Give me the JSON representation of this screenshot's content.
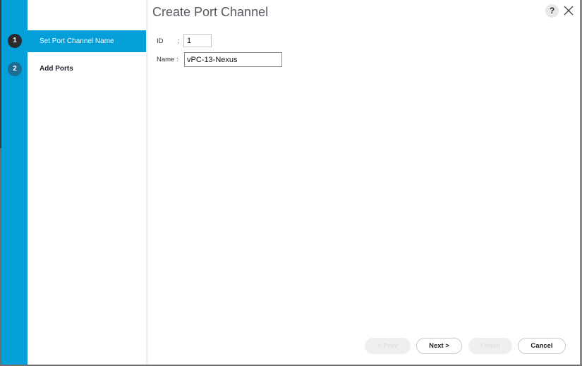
{
  "dialog": {
    "title": "Create Port Channel",
    "help_label": "?",
    "close_icon": "close-icon"
  },
  "steps": [
    {
      "number": "1",
      "label": "Set Port Channel Name",
      "active": true
    },
    {
      "number": "2",
      "label": "Add Ports",
      "active": false
    }
  ],
  "form": {
    "id_label": "ID",
    "id_colon": ":",
    "id_value": "1",
    "name_label": "Name :",
    "name_value": "vPC-13-Nexus"
  },
  "footer": {
    "prev_label": "< Prev",
    "next_label": "Next >",
    "finish_label": "Finish",
    "cancel_label": "Cancel"
  },
  "colors": {
    "accent": "#049fd9",
    "active_step_circle": "#2b2b2e",
    "inactive_step_circle": "#1b6f97"
  }
}
